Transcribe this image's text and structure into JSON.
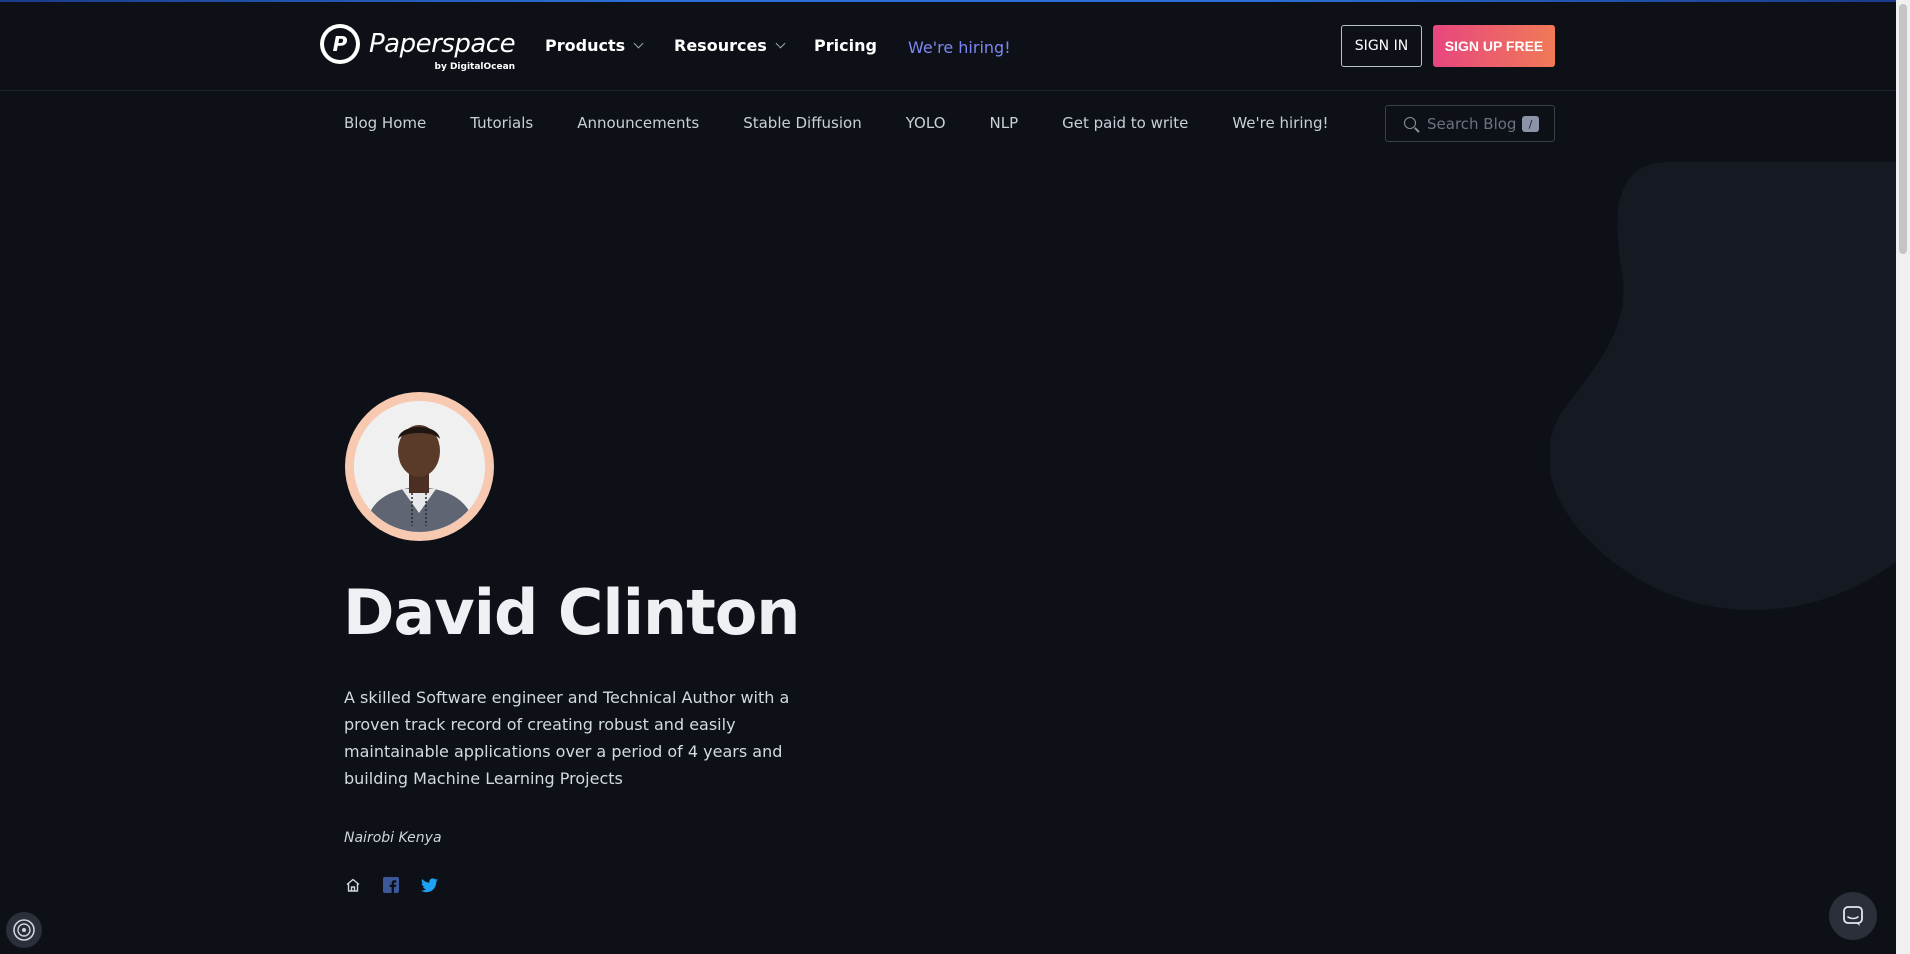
{
  "brand": {
    "name": "Paperspace",
    "byline": "by DigitalOcean",
    "mark": "P"
  },
  "nav": {
    "products": "Products",
    "resources": "Resources",
    "pricing": "Pricing",
    "hiring": "We're hiring!",
    "signin": "SIGN IN",
    "signup": "SIGN UP FREE"
  },
  "subnav": {
    "items": [
      "Blog Home",
      "Tutorials",
      "Announcements",
      "Stable Diffusion",
      "YOLO",
      "NLP",
      "Get paid to write",
      "We're hiring!"
    ]
  },
  "search": {
    "placeholder": "Search Blog",
    "shortcut": "/"
  },
  "author": {
    "name": "David Clinton",
    "bio": "A skilled Software engineer and Technical Author with a proven track record of creating robust and easily maintainable applications over a period of 4 years and building Machine Learning Projects",
    "location": "Nairobi Kenya"
  },
  "social": [
    "home-icon",
    "facebook-icon",
    "twitter-icon"
  ],
  "colors": {
    "background": "#0d1117",
    "accent_link": "#7d86f0",
    "signup_gradient_start": "#e8467e",
    "signup_gradient_end": "#f07a57",
    "avatar_ring": "#f7c9b1",
    "facebook": "#3b5998",
    "twitter": "#1da1f2"
  }
}
